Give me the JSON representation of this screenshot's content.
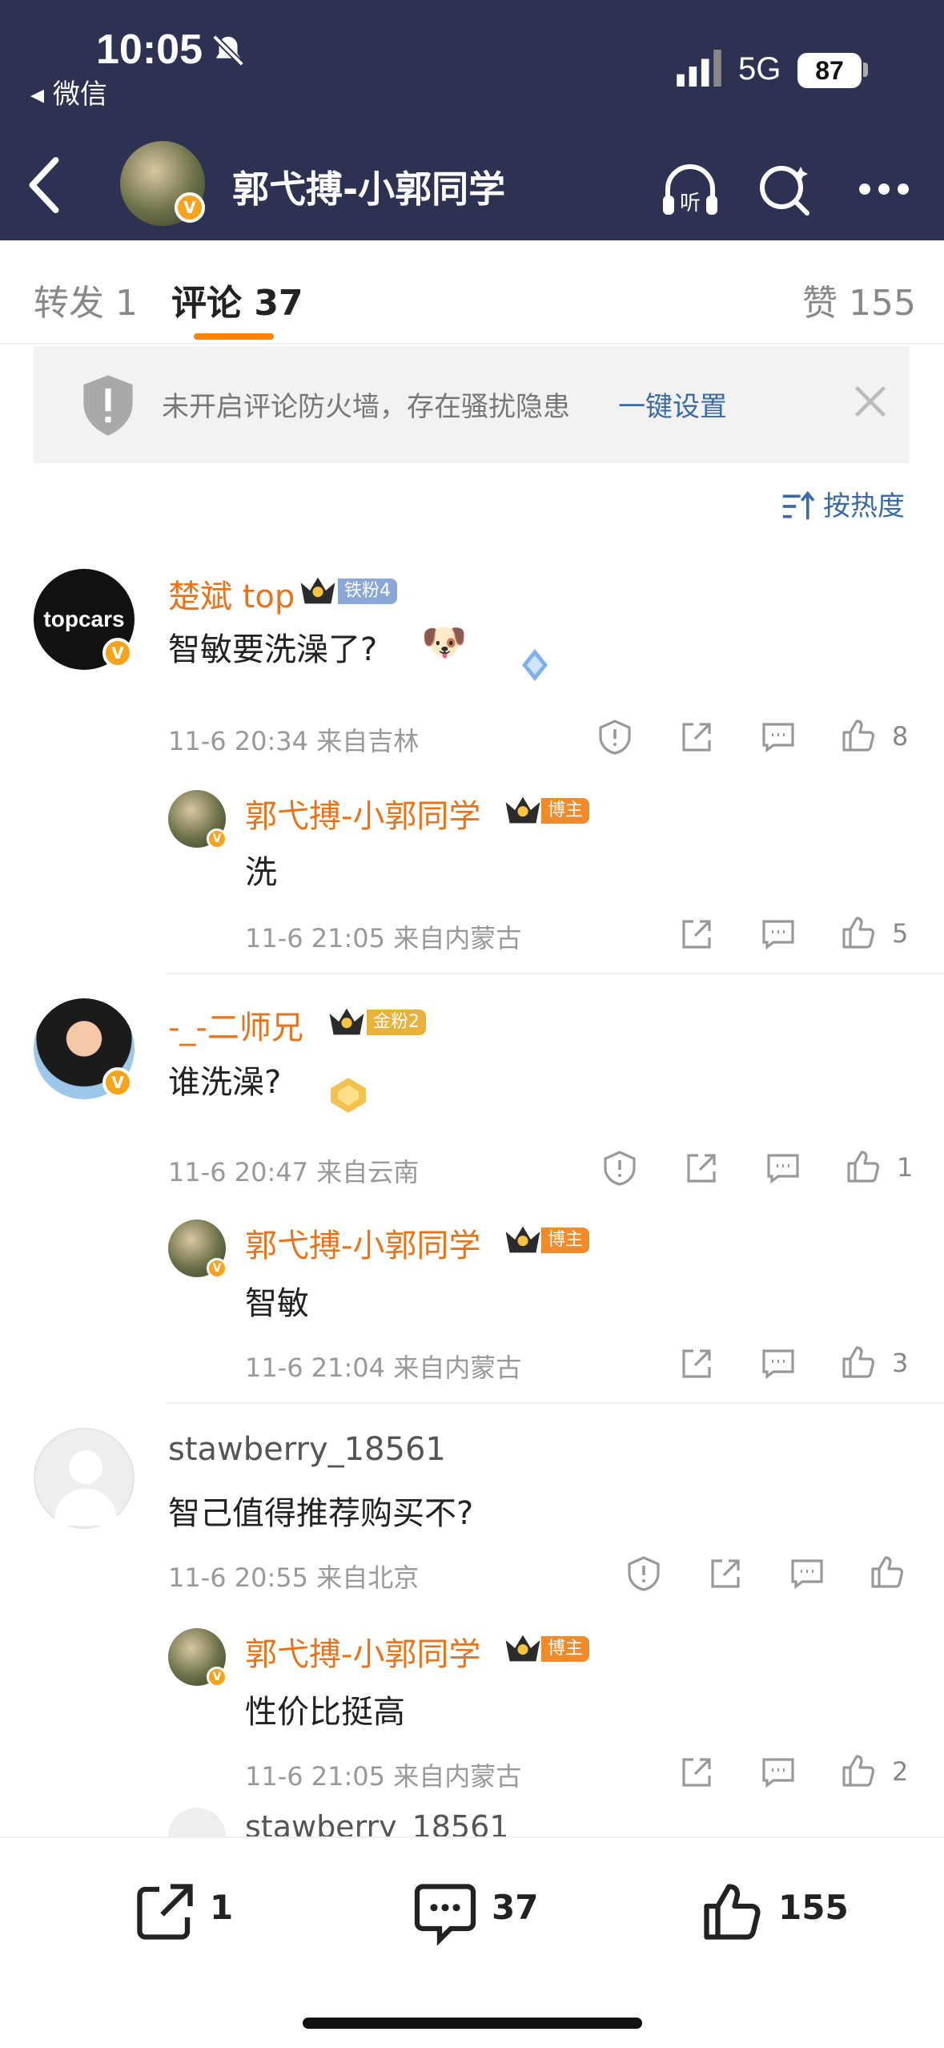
{
  "status": {
    "time": "10:05",
    "back_app": "◂ 微信",
    "network": "5G",
    "battery": "87"
  },
  "nav": {
    "title": "郭弋搏-小郭同学",
    "listen_label": "听"
  },
  "tabs": {
    "forward": "转发 1",
    "comments": "评论 37",
    "likes": "赞 155"
  },
  "firewall": {
    "text": "未开启评论防火墙，存在骚扰隐患",
    "link": "一键设置"
  },
  "sort": {
    "label": "按热度"
  },
  "comments": [
    {
      "user": "楚斌 top",
      "fan_badge": "铁粉4",
      "text": "智敏要洗澡了?",
      "emoji": "🐶",
      "meta": "11-6 20:34 来自吉林",
      "likes": "8",
      "avatar_label": "topcars",
      "reply": {
        "user": "郭弋搏-小郭同学",
        "badge": "博主",
        "text": "洗",
        "meta": "11-6 21:05 来自内蒙古",
        "likes": "5"
      }
    },
    {
      "user": "-_-二师兄",
      "fan_badge": "金粉2",
      "text": "谁洗澡?",
      "meta": "11-6 20:47 来自云南",
      "likes": "1",
      "reply": {
        "user": "郭弋搏-小郭同学",
        "badge": "博主",
        "text": "智敏",
        "meta": "11-6 21:04 来自内蒙古",
        "likes": "3"
      }
    },
    {
      "user": "stawberry_18561",
      "text": "智己值得推荐购买不?",
      "meta": "11-6 20:55 来自北京",
      "likes": "",
      "reply": {
        "user": "郭弋搏-小郭同学",
        "badge": "博主",
        "text": "性价比挺高",
        "meta": "11-6 21:05 来自内蒙古",
        "likes": "2"
      }
    }
  ],
  "partial_user": "stawberry_18561",
  "bottom": {
    "forward": "1",
    "comments": "37",
    "likes": "155"
  },
  "colors": {
    "header": "#2d3152",
    "accent": "#ff8200",
    "username": "#e8731a",
    "link": "#3b6aa6"
  }
}
